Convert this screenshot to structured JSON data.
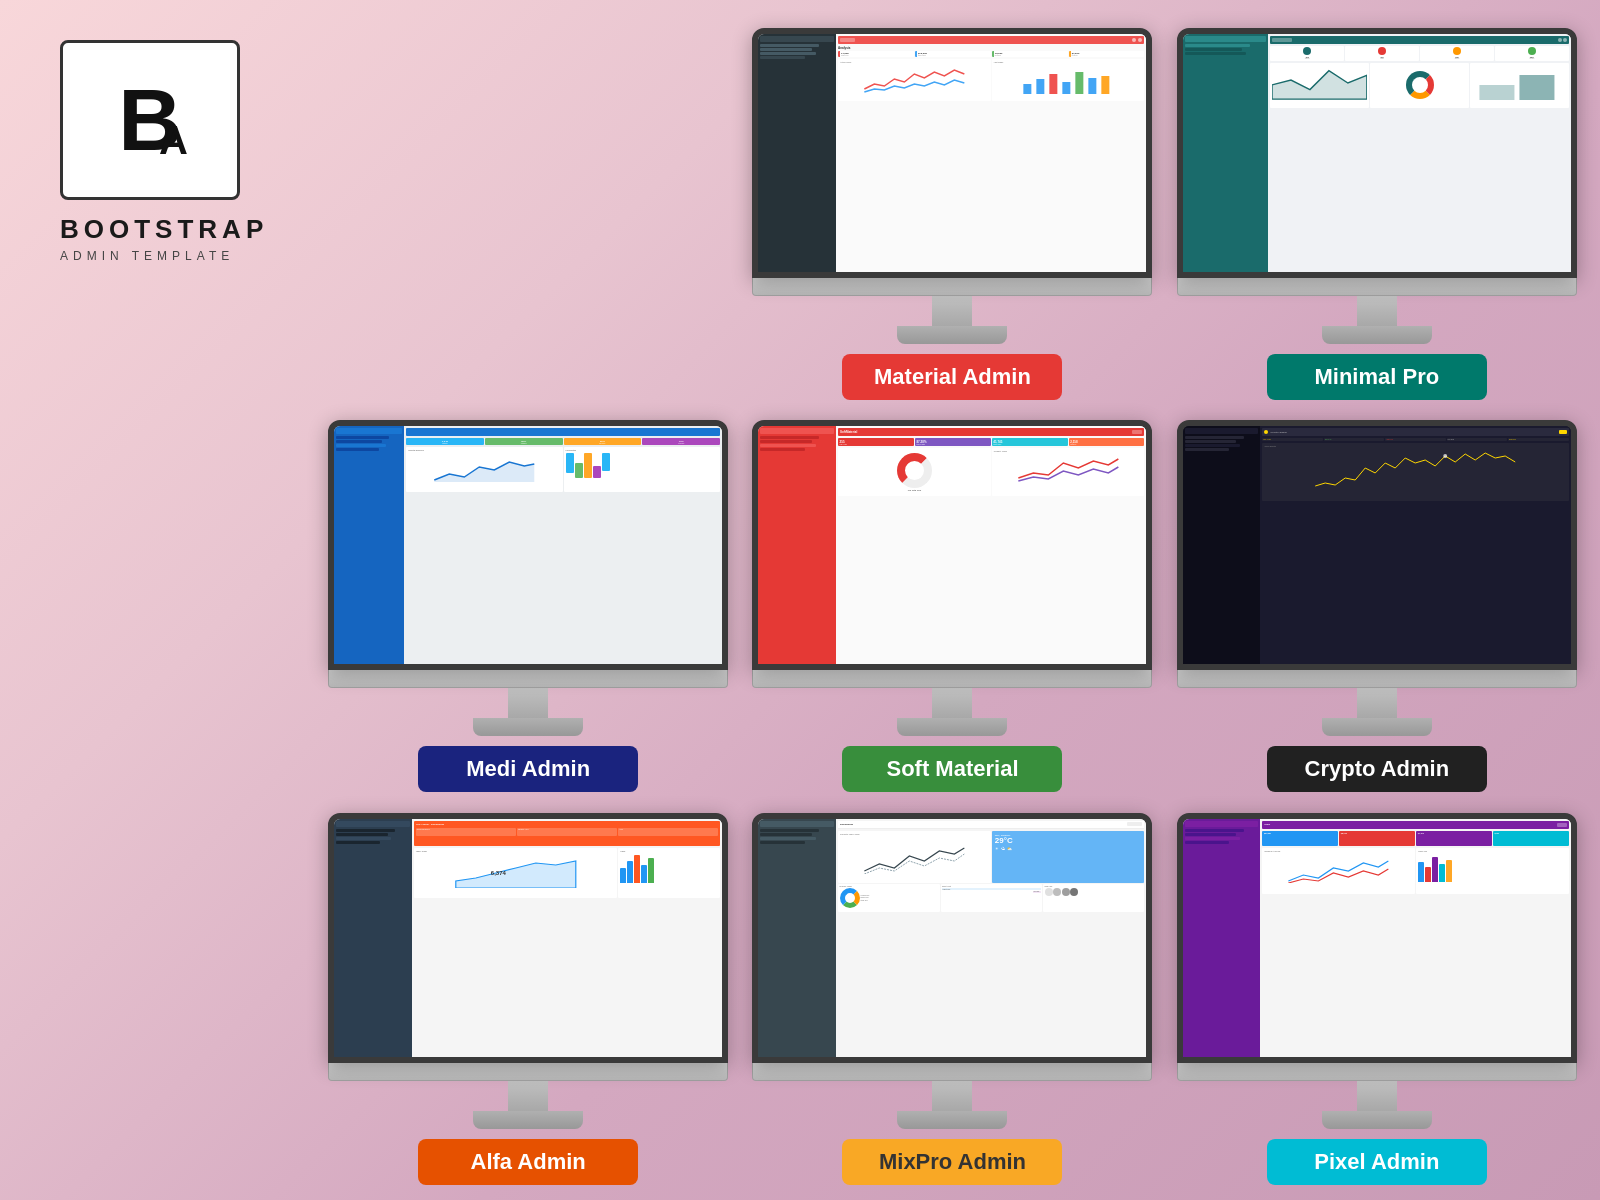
{
  "brand": {
    "logo_b": "B",
    "logo_a": "A",
    "title": "BOOTSTRAP",
    "subtitle": "ADMIN TEMPLATE"
  },
  "templates": [
    {
      "id": "material-admin",
      "label": "Material Admin",
      "label_color": "#e53935",
      "screen_type": "material",
      "row": 0,
      "col": 1
    },
    {
      "id": "minimal-pro",
      "label": "Minimal Pro",
      "label_color": "#00796b",
      "screen_type": "minimal",
      "row": 0,
      "col": 2
    },
    {
      "id": "medi-admin",
      "label": "Medi Admin",
      "label_color": "#1a237e",
      "screen_type": "medi",
      "row": 1,
      "col": 0
    },
    {
      "id": "soft-material",
      "label": "Soft Material",
      "label_color": "#388e3c",
      "screen_type": "soft",
      "row": 1,
      "col": 1
    },
    {
      "id": "crypto-admin",
      "label": "Crypto Admin",
      "label_color": "#212121",
      "screen_type": "crypto",
      "row": 1,
      "col": 2
    },
    {
      "id": "alfa-admin",
      "label": "Alfa Admin",
      "label_color": "#e65100",
      "screen_type": "alfa",
      "row": 2,
      "col": 0
    },
    {
      "id": "mixpro-admin",
      "label": "MixPro Admin",
      "label_color": "#f9a825",
      "screen_type": "mixpro",
      "row": 2,
      "col": 1
    },
    {
      "id": "pixel-admin",
      "label": "Pixel Admin",
      "label_color": "#00bcd4",
      "screen_type": "pixel",
      "row": 2,
      "col": 2
    }
  ]
}
